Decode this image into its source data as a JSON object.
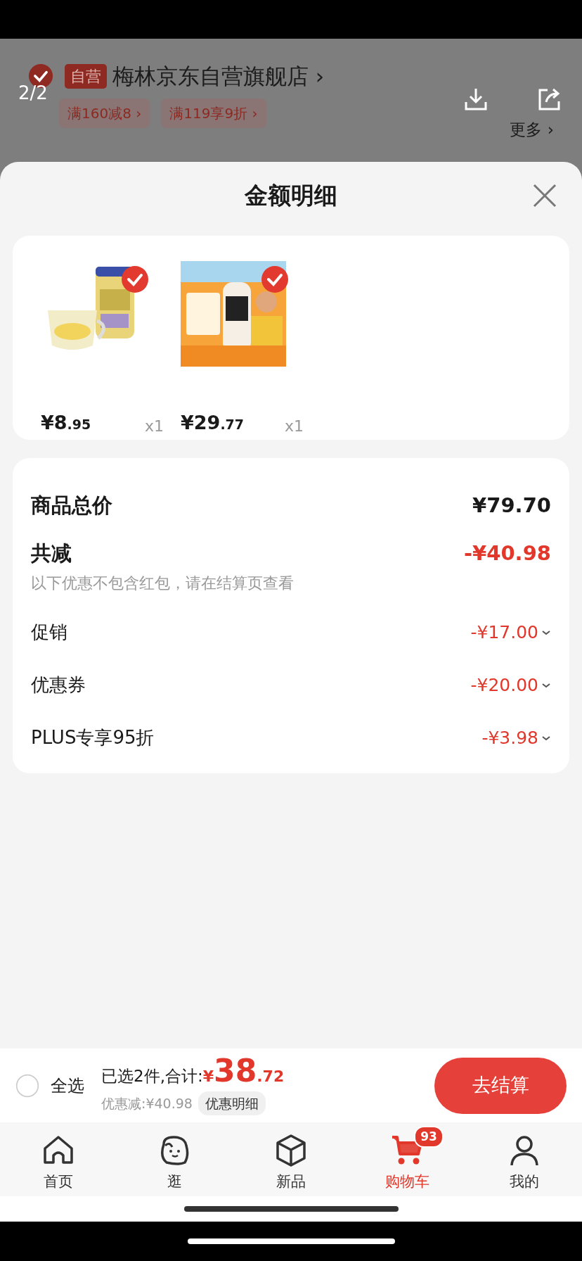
{
  "background_page": {
    "page_indicator": "2/2",
    "store": {
      "checked": true,
      "badge": "自营",
      "name": "梅林京东自营旗舰店",
      "chevron": "›"
    },
    "coupons": [
      "满160减8 ›",
      "满119享9折 ›"
    ],
    "more": "更多 ›"
  },
  "sheet": {
    "title": "金额明细",
    "products": [
      {
        "price_main": "¥8",
        "price_decimal": ".95",
        "quantity": "x1",
        "selected": true
      },
      {
        "price_main": "¥29",
        "price_decimal": ".77",
        "quantity": "x1",
        "selected": true
      }
    ],
    "summary": {
      "total_label": "商品总价",
      "total": "¥79.70",
      "discount_label": "共减",
      "discount": "-¥40.98",
      "note": "以下优惠不包含红包，请在结算页查看",
      "items": [
        {
          "label": "促销",
          "amount": "-¥17.00"
        },
        {
          "label": "优惠券",
          "amount": "-¥20.00"
        },
        {
          "label": "PLUS专享95折",
          "amount": "-¥3.98"
        }
      ]
    }
  },
  "checkout_bar": {
    "select_all": {
      "label": "全选",
      "checked": false
    },
    "selected_text": "已选2件,合计:",
    "currency": "¥",
    "amount_main": "38",
    "amount_decimal": ".72",
    "discount_text": "优惠减:¥40.98",
    "detail_button": "优惠明细",
    "checkout_button": "去结算"
  },
  "tab_bar": [
    {
      "label": "首页",
      "selected": false
    },
    {
      "label": "逛",
      "selected": false
    },
    {
      "label": "新品",
      "selected": false
    },
    {
      "label": "购物车",
      "selected": true,
      "badge": "93"
    },
    {
      "label": "我的",
      "selected": false
    }
  ]
}
